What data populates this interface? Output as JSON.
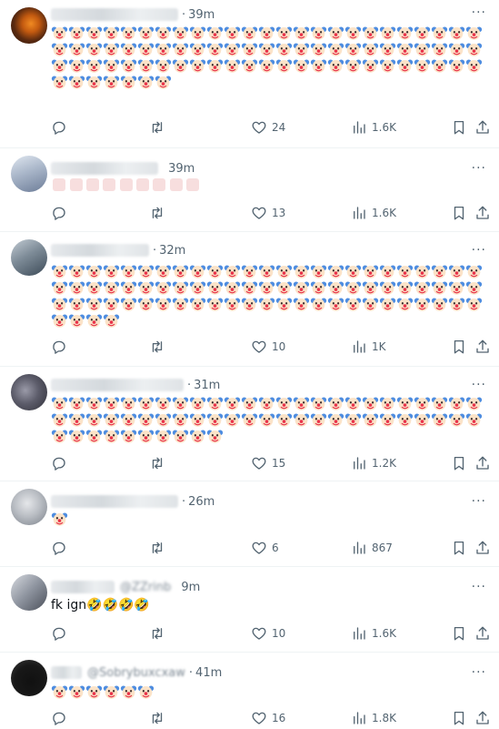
{
  "more_label": "···",
  "tweets": [
    {
      "time": "39m",
      "clown_count": 82,
      "actions": {
        "likes": "24",
        "views": "1.6K"
      }
    },
    {
      "time": "39m",
      "thumbs_count": 9,
      "actions": {
        "likes": "13",
        "views": "1.6K"
      }
    },
    {
      "time": "32m",
      "clown_count": 79,
      "actions": {
        "likes": "10",
        "views": "1K"
      }
    },
    {
      "time": "31m",
      "clown_count": 60,
      "actions": {
        "likes": "15",
        "views": "1.2K"
      }
    },
    {
      "time": "26m",
      "clown_count": 1,
      "actions": {
        "likes": "6",
        "views": "867"
      }
    },
    {
      "handle_partial": "@ZZrinb",
      "time": "9m",
      "text": "fk ign🤣🤣🤣🤣",
      "actions": {
        "likes": "10",
        "views": "1.6K"
      }
    },
    {
      "handle_partial": "@Sobrybuxcxaw",
      "time": "41m",
      "clown_count": 6,
      "actions": {
        "likes": "16",
        "views": "1.8K"
      }
    }
  ],
  "colors": {
    "divider": "#eff3f4",
    "muted": "#536471",
    "text": "#0f1419"
  }
}
